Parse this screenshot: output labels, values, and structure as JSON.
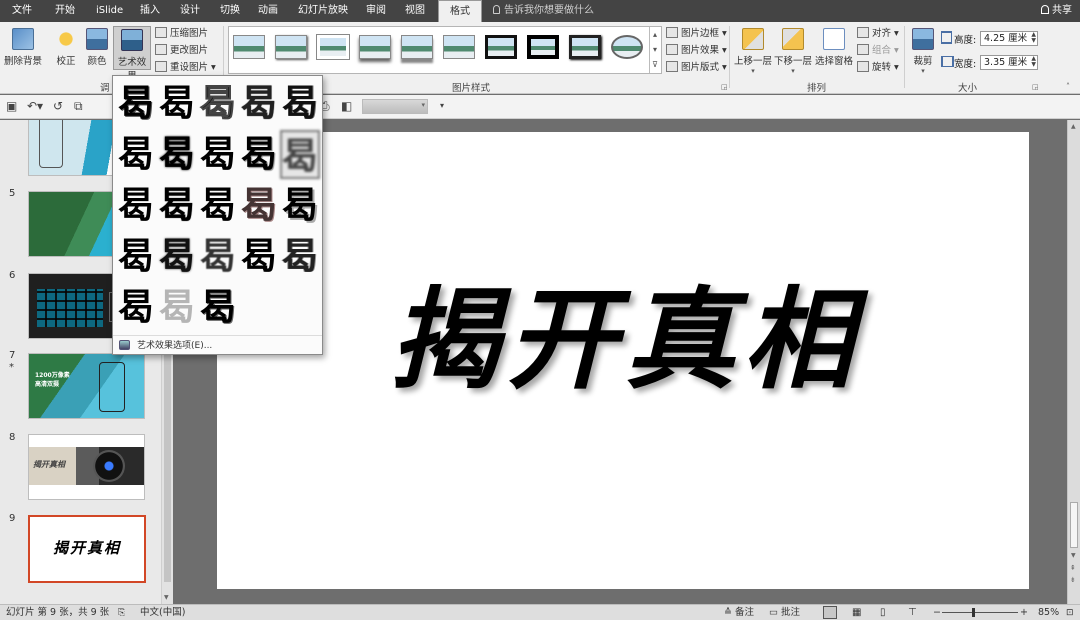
{
  "tabs": [
    "文件",
    "开始",
    "iSlide",
    "插入",
    "设计",
    "切换",
    "动画",
    "幻灯片放映",
    "审阅",
    "视图",
    "格式"
  ],
  "tell_me": "告诉我你想要做什么",
  "share": "共享",
  "ribbon": {
    "remove_bg": "删除背景",
    "corrections": "校正",
    "color": "颜色",
    "artistic": "艺术效果",
    "compress": "压缩图片",
    "change": "更改图片",
    "reset": "重设图片",
    "adjust_group": "调",
    "picture_styles_group": "图片样式",
    "border": "图片边框",
    "effects": "图片效果",
    "layout": "图片版式",
    "bring_forward": "上移一层",
    "send_backward": "下移一层",
    "selection_pane": "选择窗格",
    "align": "对齐",
    "group": "组合",
    "rotate": "旋转",
    "arrange_group": "排列",
    "crop": "裁剪",
    "height_label": "高度:",
    "height_value": "4.25 厘米",
    "width_label": "宽度:",
    "width_value": "3.35 厘米",
    "size_group": "大小"
  },
  "art_effects": {
    "glyph": "曷",
    "options": "艺术效果选项(E)...",
    "selected_index": 9,
    "count": 23
  },
  "slides": [
    {
      "num": "5",
      "star": ""
    },
    {
      "num": "6",
      "star": ""
    },
    {
      "num": "7",
      "star": "*",
      "text1": "1200万像素",
      "text2": "高清双摄"
    },
    {
      "num": "8",
      "star": "",
      "text": "揭开真相"
    },
    {
      "num": "9",
      "star": "",
      "text": "揭开真相"
    }
  ],
  "slide_title": "揭开真相",
  "status": {
    "slide_info": "幻灯片 第 9 张，共 9 张",
    "language": "中文(中国)",
    "notes": "备注",
    "comments": "批注",
    "zoom": "85%"
  },
  "colors": {
    "accent": "#d24726",
    "tabbar": "#444444",
    "canvas": "#6e6e6e"
  }
}
